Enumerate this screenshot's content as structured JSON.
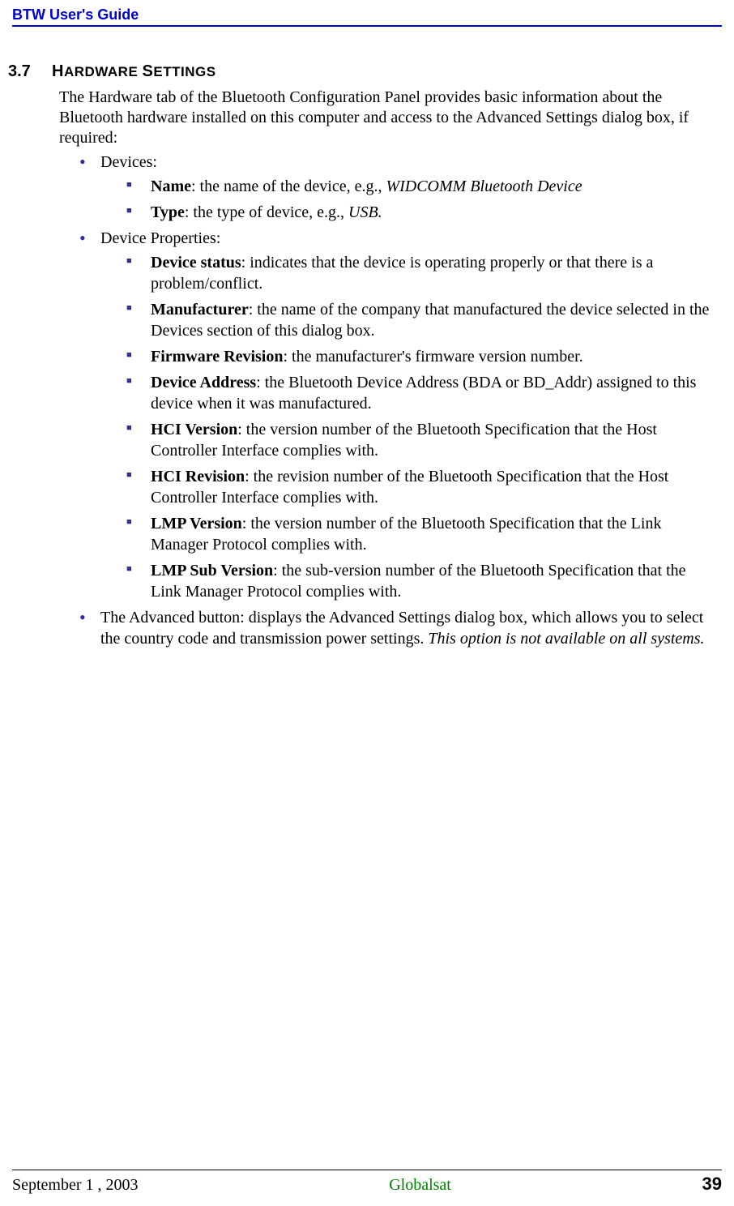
{
  "header": {
    "title": "BTW User's Guide"
  },
  "section": {
    "number": "3.7",
    "title_caps_1": "H",
    "title_lower_1": "ARDWARE ",
    "title_caps_2": "S",
    "title_lower_2": "ETTINGS",
    "intro": "The Hardware tab of the Bluetooth Configuration Panel provides basic information about the Bluetooth hardware installed on this computer and access to the Advanced Settings dialog box, if required:"
  },
  "bullets": {
    "devices_label": "Devices:",
    "devices": {
      "name": {
        "term": "Name",
        "desc": ": the name of the device, e.g., ",
        "example": "WIDCOMM Bluetooth Device"
      },
      "type": {
        "term": "Type",
        "desc": ": the type of device, e.g., ",
        "example": "USB."
      }
    },
    "properties_label": "Device Properties:",
    "properties": {
      "device_status": {
        "term": "Device status",
        "desc": ": indicates that the device is operating properly or that there is a problem/conflict."
      },
      "manufacturer": {
        "term": "Manufacturer",
        "desc": ": the name of the company that manufactured the device selected in the Devices section of this dialog box."
      },
      "firmware": {
        "term": "Firmware Revision",
        "desc": ": the manufacturer's firmware version number."
      },
      "device_address": {
        "term": "Device Address",
        "desc": ": the Bluetooth Device Address (BDA or BD_Addr) assigned to this device when it was manufactured."
      },
      "hci_version": {
        "term": "HCI Version",
        "desc": ": the version number of the Bluetooth Specification that the Host Controller Interface complies with."
      },
      "hci_revision": {
        "term": "HCI Revision",
        "desc": ": the revision number of the Bluetooth Specification that the Host Controller Interface complies with."
      },
      "lmp_version": {
        "term": "LMP Version",
        "desc": ": the version number of the Bluetooth Specification that the Link Manager Protocol complies with."
      },
      "lmp_sub": {
        "term": "LMP Sub Version",
        "desc": ": the sub-version number of the Bluetooth Specification that the Link Manager Protocol complies with."
      }
    },
    "advanced": {
      "text": "The Advanced button: displays the Advanced Settings dialog box, which allows you to select the country code and transmission power settings. ",
      "italic": "This option is not available on all systems."
    }
  },
  "footer": {
    "date": "September 1 , 2003",
    "center": "Globalsat",
    "page": "39"
  }
}
